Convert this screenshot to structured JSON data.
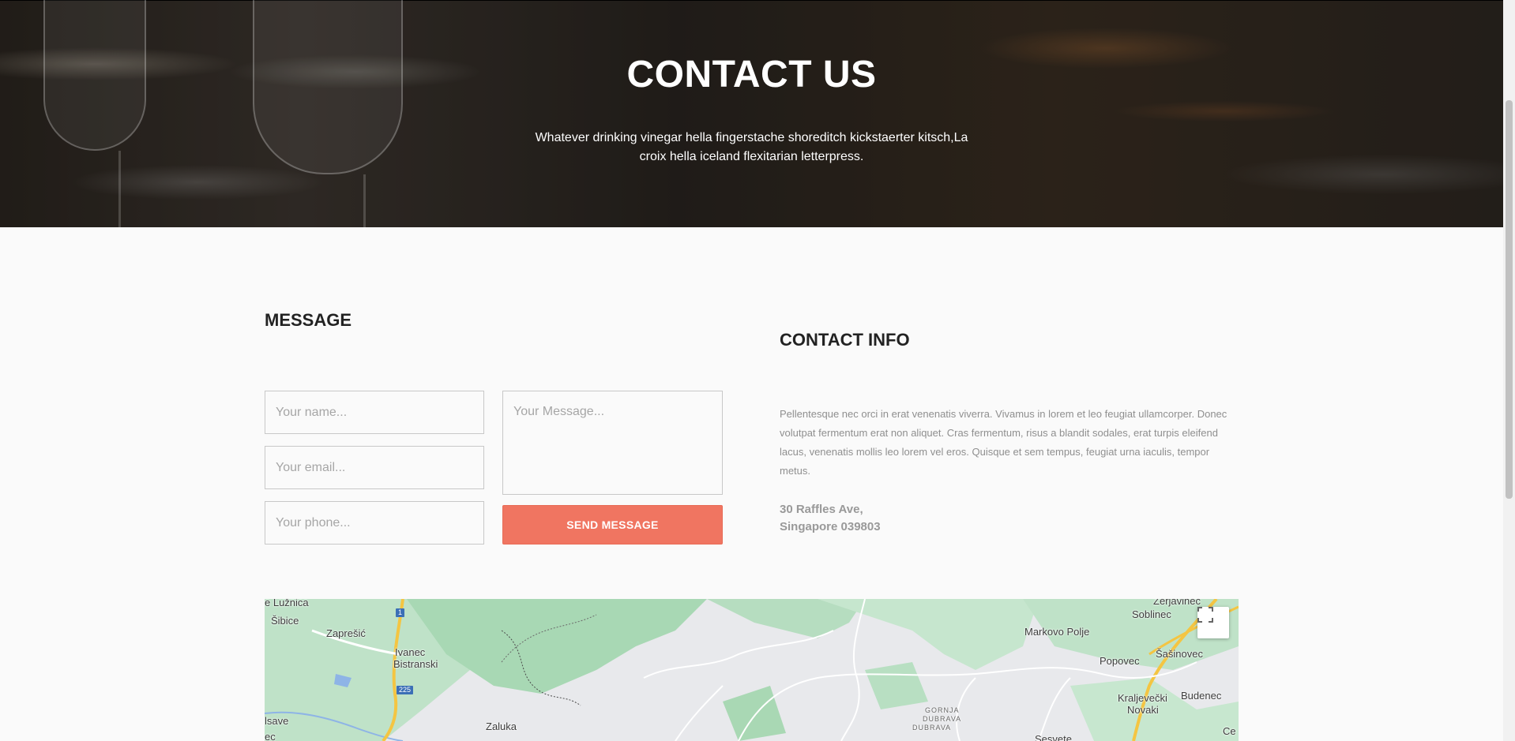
{
  "hero": {
    "title": "CONTACT US",
    "subtitle": "Whatever drinking vinegar hella fingerstache shoreditch kickstaerter kitsch,La croix hella iceland flexitarian letterpress."
  },
  "message": {
    "heading": "MESSAGE",
    "name_placeholder": "Your name...",
    "email_placeholder": "Your email...",
    "phone_placeholder": "Your phone...",
    "message_placeholder": "Your Message...",
    "send_label": "SEND MESSAGE"
  },
  "contact_info": {
    "heading": "CONTACT INFO",
    "text": "Pellentesque nec orci in erat venenatis viverra. Vivamus in lorem et leo feugiat ullamcorper. Donec volutpat fermentum erat non aliquet. Cras fermentum, risus a blandit sodales, erat turpis eleifend lacus, venenatis mollis leo lorem vel eros. Quisque et sem tempus, feugiat urna iaculis, tempor metus.",
    "address_line1": "30 Raffles Ave,",
    "address_line2": "Singapore 039803"
  },
  "map": {
    "labels": {
      "luznica": "e Lužnica",
      "sibice": "Šibice",
      "zapresic": "Zaprešić",
      "ivanec": "Ivanec",
      "bistranski": "Bistranski",
      "isave": "lsave",
      "ec": "ec",
      "zaluka": "Zaluka",
      "gornja": "GORNJA",
      "dubrava1": "DUBRAVA",
      "dubrava2": "DUBRAVA",
      "markovo": "Markovo Polje",
      "zerjavinec": "Zerjavinec",
      "soblinec": "Soblinec",
      "sasinovec": "Šašinovec",
      "popovec": "Popovec",
      "kraljevecki": "Kraljevečki",
      "novaki": "Novaki",
      "budenec": "Budenec",
      "sesvete": "Sesvete",
      "ce": "Ce"
    },
    "road_badges": {
      "r1": "1",
      "r225": "225"
    },
    "fullscreen_icon": "fullscreen-icon"
  },
  "colors": {
    "accent": "#f07561",
    "heading": "#222222",
    "muted_text": "#8f8f8f"
  }
}
